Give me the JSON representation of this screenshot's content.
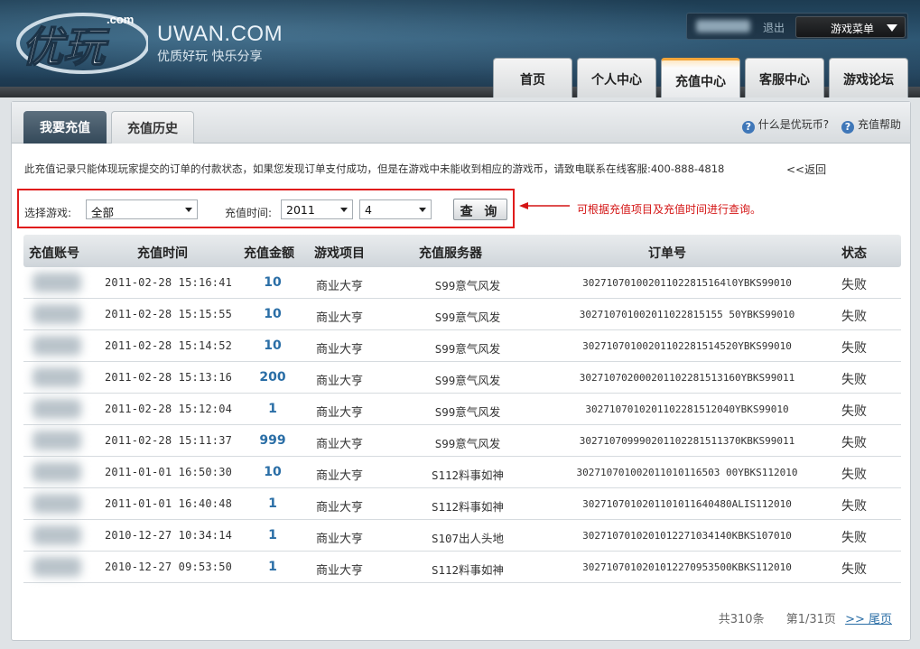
{
  "brand": {
    "logo_text": "优玩",
    "logo_domain": ".com",
    "site_name": "UWAN.COM",
    "slogan": "优质好玩  快乐分享"
  },
  "top_bar": {
    "logout": "退出",
    "game_menu": "游戏菜单"
  },
  "nav": {
    "tabs": [
      {
        "label": "首页"
      },
      {
        "label": "个人中心"
      },
      {
        "label": "充值中心"
      },
      {
        "label": "客服中心"
      },
      {
        "label": "游戏论坛"
      }
    ],
    "active": "充值中心"
  },
  "subnav": {
    "tabs": [
      {
        "label": "我要充值"
      },
      {
        "label": "充值历史"
      }
    ],
    "help": [
      {
        "label": "什么是优玩币?"
      },
      {
        "label": "充值帮助"
      }
    ]
  },
  "notice": "此充值记录只能体现玩家提交的订单的付款状态，如果您发现订单支付成功，但是在游戏中未能收到相应的游戏币，请致电联系在线客服:400-888-4818",
  "back_link": "<<返回",
  "filter": {
    "game_label": "选择游戏:",
    "game_value": "全部",
    "time_label": "充值时间:",
    "year_value": "2011",
    "month_value": "4",
    "query_button": "查 询",
    "annotation": "可根据充值项目及充值时间进行查询。"
  },
  "table": {
    "headers": [
      "充值账号",
      "充值时间",
      "充值金额",
      "游戏项目",
      "充值服务器",
      "订单号",
      "状态"
    ],
    "rows": [
      {
        "time": "2011-02-28 15:16:41",
        "amount": "10",
        "game": "商业大亨",
        "server": "S99意气风发",
        "order": "302710701002011022815164l0YBKS99010",
        "status": "失败"
      },
      {
        "time": "2011-02-28 15:15:55",
        "amount": "10",
        "game": "商业大亨",
        "server": "S99意气风发",
        "order": "302710701002011022815155 50YBKS99010",
        "status": "失败"
      },
      {
        "time": "2011-02-28 15:14:52",
        "amount": "10",
        "game": "商业大亨",
        "server": "S99意气风发",
        "order": "30271070100201102281514520YBKS99010",
        "status": "失败"
      },
      {
        "time": "2011-02-28 15:13:16",
        "amount": "200",
        "game": "商业大亨",
        "server": "S99意气风发",
        "order": "302710702000201102281513160YBKS99011",
        "status": "失败"
      },
      {
        "time": "2011-02-28 15:12:04",
        "amount": "1",
        "game": "商业大亨",
        "server": "S99意气风发",
        "order": "3027107010201102281512040YBKS99010",
        "status": "失败"
      },
      {
        "time": "2011-02-28 15:11:37",
        "amount": "999",
        "game": "商业大亨",
        "server": "S99意气风发",
        "order": "302710709990201102281511370KBKS99011",
        "status": "失败"
      },
      {
        "time": "2011-01-01 16:50:30",
        "amount": "10",
        "game": "商业大亨",
        "server": "S112料事如神",
        "order": "302710701002011010116503 00YBKS112010",
        "status": "失败"
      },
      {
        "time": "2011-01-01 16:40:48",
        "amount": "1",
        "game": "商业大亨",
        "server": "S112料事如神",
        "order": "3027107010201101011640480ALIS112010",
        "status": "失败"
      },
      {
        "time": "2010-12-27 10:34:14",
        "amount": "1",
        "game": "商业大亨",
        "server": "S107出人头地",
        "order": "3027107010201012271034140KBKS107010",
        "status": "失败"
      },
      {
        "time": "2010-12-27 09:53:50",
        "amount": "1",
        "game": "商业大亨",
        "server": "S112料事如神",
        "order": "3027107010201012270953500KBKS112010",
        "status": "失败"
      }
    ]
  },
  "pager": {
    "total": "共310条",
    "page": "第1/31页",
    "last": ">>  尾页"
  }
}
